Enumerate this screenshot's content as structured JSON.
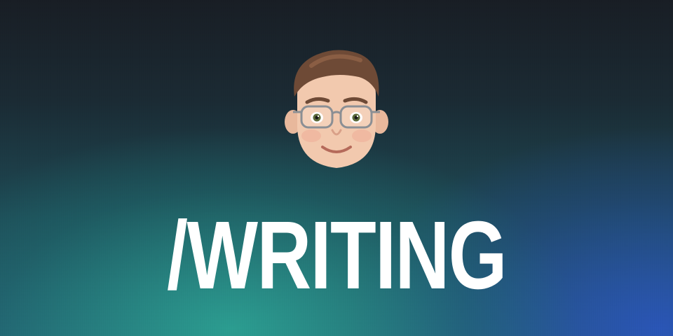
{
  "banner": {
    "title": "/WRITING",
    "avatar_icon": "memoji-avatar-icon"
  },
  "colors": {
    "top": "#181d24",
    "teal": "#2ca896",
    "blue": "#2a54be",
    "text": "#ffffff"
  }
}
